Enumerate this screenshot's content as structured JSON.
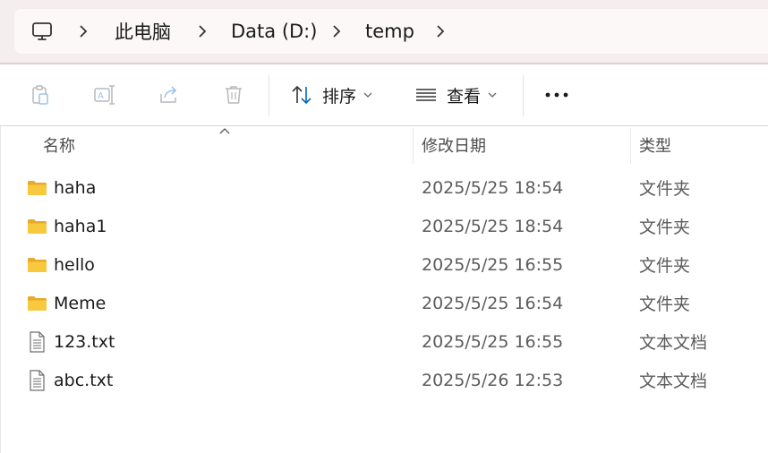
{
  "breadcrumb": {
    "items": [
      {
        "label": "此电脑"
      },
      {
        "label": "Data (D:)"
      },
      {
        "label": "temp"
      }
    ]
  },
  "toolbar": {
    "sort_label": "排序",
    "view_label": "查看"
  },
  "columns": {
    "name": "名称",
    "date": "修改日期",
    "type": "类型"
  },
  "files": [
    {
      "name": "haha",
      "date": "2025/5/25 18:54",
      "type": "文件夹",
      "icon": "folder-icon"
    },
    {
      "name": "haha1",
      "date": "2025/5/25 18:54",
      "type": "文件夹",
      "icon": "folder-icon"
    },
    {
      "name": "hello",
      "date": "2025/5/25 16:55",
      "type": "文件夹",
      "icon": "folder-icon"
    },
    {
      "name": "Meme",
      "date": "2025/5/25 16:54",
      "type": "文件夹",
      "icon": "folder-icon"
    },
    {
      "name": "123.txt",
      "date": "2025/5/25 16:55",
      "type": "文本文档",
      "icon": "text-file-icon"
    },
    {
      "name": "abc.txt",
      "date": "2025/5/26 12:53",
      "type": "文本文档",
      "icon": "text-file-icon"
    }
  ],
  "colors": {
    "address_band": "#f4eeee",
    "accent": "#0067c0",
    "folder_yellow": "#f8c93e"
  }
}
